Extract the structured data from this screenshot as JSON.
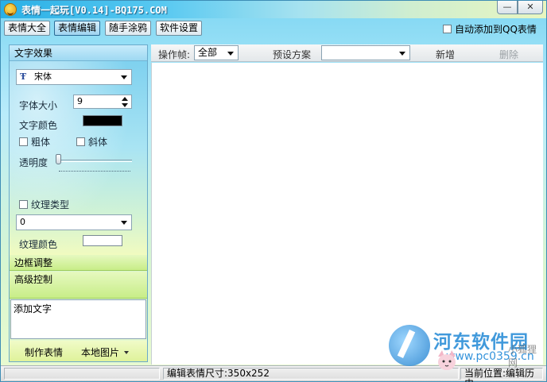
{
  "window": {
    "title": "表情一起玩[V0.14]-BQ175.COM",
    "min_glyph": "—",
    "close_glyph": "✕"
  },
  "menu": {
    "tabs": [
      {
        "label": "表情大全"
      },
      {
        "label": "表情编辑"
      },
      {
        "label": "随手涂鸦"
      },
      {
        "label": "软件设置"
      }
    ],
    "auto_add_label": "自动添加到QQ表情"
  },
  "left": {
    "section_text_effects": "文字效果",
    "font_name": "宋体",
    "font_icon": "Ŧ",
    "font_size_label": "字体大小",
    "font_size_value": "9",
    "text_color_label": "文字颜色",
    "text_color": "#000000",
    "bold_label": "粗体",
    "italic_label": "斜体",
    "opacity_label": "透明度",
    "texture_type_label": "纹理类型",
    "texture_value": "0",
    "texture_color_label": "纹理颜色",
    "texture_color": "#ffffff",
    "section_border": "边框调整",
    "section_advanced": "高级控制",
    "textarea_value": "添加文字",
    "make_button": "制作表情",
    "local_image_button": "本地图片"
  },
  "toolbar": {
    "frame_label": "操作帧:",
    "frame_value": "全部",
    "preset_label": "预设方案",
    "preset_value": "",
    "new_button": "新增",
    "delete_button": "删除"
  },
  "status": {
    "size_text": "编辑表情尺寸:350x252",
    "position_text": "当前位置:编辑历史"
  },
  "watermark": {
    "title": "河东软件园",
    "url": "www.pc0359.cn",
    "fox_text": "小狐狸网"
  }
}
